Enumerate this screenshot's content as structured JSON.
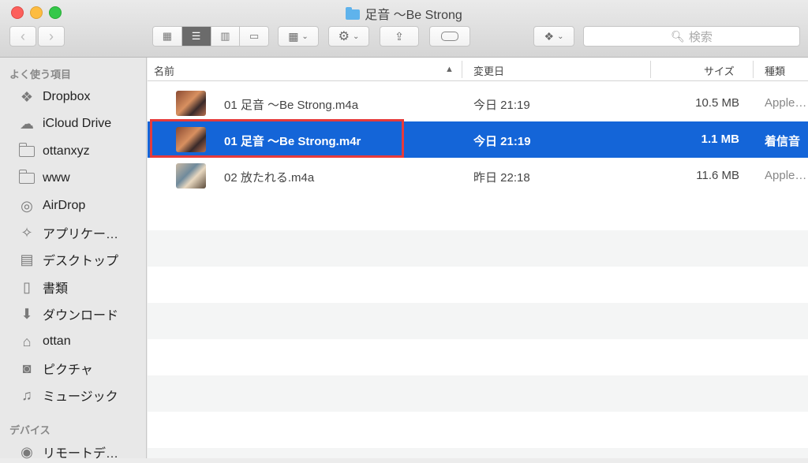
{
  "window": {
    "title": "足音 〜Be Strong"
  },
  "toolbar": {
    "search_placeholder": "検索"
  },
  "sidebar": {
    "favorites_heading": "よく使う項目",
    "items": [
      {
        "label": "Dropbox",
        "icon": "dropbox-icon"
      },
      {
        "label": "iCloud Drive",
        "icon": "cloud-icon"
      },
      {
        "label": "ottanxyz",
        "icon": "folder-icon"
      },
      {
        "label": "www",
        "icon": "folder-icon"
      },
      {
        "label": "AirDrop",
        "icon": "airdrop-icon"
      },
      {
        "label": "アプリケー…",
        "icon": "applications-icon"
      },
      {
        "label": "デスクトップ",
        "icon": "desktop-icon"
      },
      {
        "label": "書類",
        "icon": "documents-icon"
      },
      {
        "label": "ダウンロード",
        "icon": "download-icon"
      },
      {
        "label": "ottan",
        "icon": "home-icon"
      },
      {
        "label": "ピクチャ",
        "icon": "camera-icon"
      },
      {
        "label": "ミュージック",
        "icon": "music-icon"
      }
    ],
    "devices_heading": "デバイス",
    "device_item": {
      "label": "リモートデ…",
      "icon": "disc-icon"
    }
  },
  "columns": {
    "name": "名前",
    "date": "変更日",
    "size": "サイズ",
    "kind": "種類"
  },
  "files": [
    {
      "name": "01 足音 〜Be Strong.m4a",
      "date": "今日 21:19",
      "size": "10.5 MB",
      "kind": "Apple…"
    },
    {
      "name": "01 足音 〜Be Strong.m4r",
      "date": "今日 21:19",
      "size": "1.1 MB",
      "kind": "着信音",
      "selected": true
    },
    {
      "name": "02 放たれる.m4a",
      "date": "昨日 22:18",
      "size": "11.6 MB",
      "kind": "Apple…"
    }
  ],
  "colors": {
    "selection": "#1465d8",
    "highlight_box": "#e63b3b"
  }
}
